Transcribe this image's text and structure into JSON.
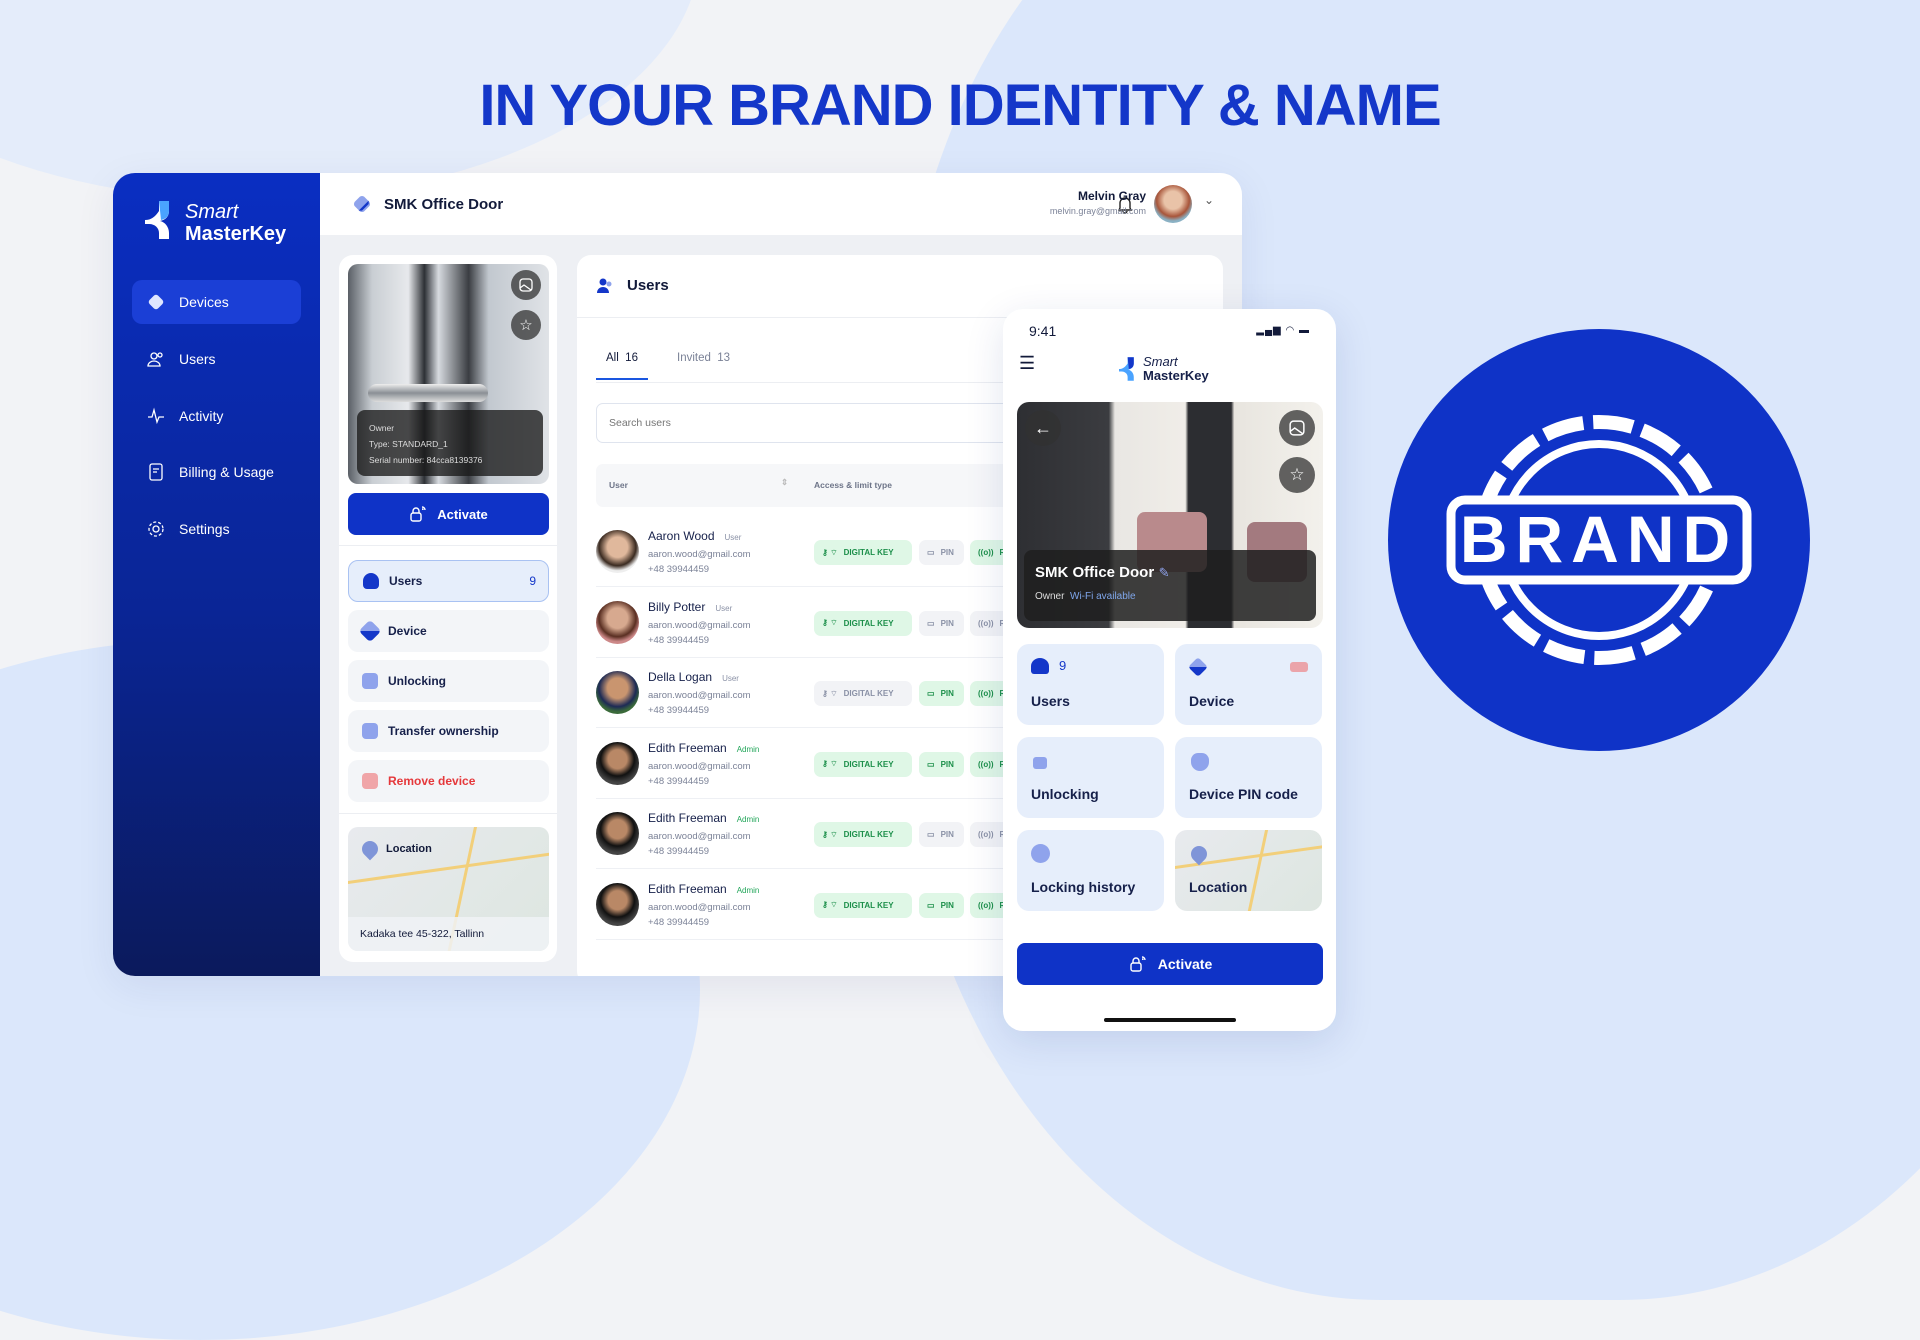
{
  "headline": "IN YOUR BRAND IDENTITY & NAME",
  "colors": {
    "brand": "#1437c9",
    "sidebar": "#0a2ec2",
    "button": "#0f33c7",
    "chip_active_bg": "#dff7e6",
    "chip_active_text": "#1c8f4a",
    "danger": "#e5383b",
    "admin_role": "#22a65a"
  },
  "logo": {
    "line1": "Smart",
    "line2": "MasterKey"
  },
  "sidebar": {
    "items": [
      {
        "label": "Devices",
        "icon": "device-icon",
        "active": true
      },
      {
        "label": "Users",
        "icon": "users-icon"
      },
      {
        "label": "Activity",
        "icon": "activity-icon"
      },
      {
        "label": "Billing & Usage",
        "icon": "receipt-icon"
      },
      {
        "label": "Settings",
        "icon": "gear-icon"
      }
    ]
  },
  "header": {
    "title": "SMK Office Door",
    "user_name": "Melvin Gray",
    "user_email": "melvin.gray@gmail.com"
  },
  "device": {
    "owner": "Owner",
    "type": "Type: STANDARD_1",
    "serial": "Serial number: 84cca8139376",
    "activate": "Activate",
    "menu": [
      {
        "label": "Users",
        "count": "9"
      },
      {
        "label": "Device"
      },
      {
        "label": "Unlocking"
      },
      {
        "label": "Transfer ownership"
      },
      {
        "label": "Remove device"
      }
    ],
    "location_label": "Location",
    "address": "Kadaka tee 45-322, Tallinn"
  },
  "users": {
    "title": "Users",
    "tabs": [
      {
        "label": "All",
        "count": "16",
        "active": true
      },
      {
        "label": "Invited",
        "count": "13"
      }
    ],
    "search_placeholder": "Search users",
    "columns": [
      "User",
      "Access & limit type"
    ],
    "chip_labels": {
      "digital": "DIGITAL KEY",
      "pin": "PIN",
      "rf": "RF"
    },
    "rows": [
      {
        "name": "Aaron Wood",
        "role": "User",
        "email": "aaron.wood@gmail.com",
        "phone": "+48 39944459",
        "digital": true,
        "pin": false,
        "rf": true
      },
      {
        "name": "Billy Potter",
        "role": "User",
        "email": "aaron.wood@gmail.com",
        "phone": "+48 39944459",
        "digital": true,
        "pin": false,
        "rf": false
      },
      {
        "name": "Della Logan",
        "role": "User",
        "email": "aaron.wood@gmail.com",
        "phone": "+48 39944459",
        "digital": false,
        "pin": true,
        "rf": true
      },
      {
        "name": "Edith Freeman",
        "role": "Admin",
        "email": "aaron.wood@gmail.com",
        "phone": "+48 39944459",
        "digital": true,
        "pin": true,
        "rf": true
      },
      {
        "name": "Edith Freeman",
        "role": "Admin",
        "email": "aaron.wood@gmail.com",
        "phone": "+48 39944459",
        "digital": true,
        "pin": false,
        "rf": false
      },
      {
        "name": "Edith Freeman",
        "role": "Admin",
        "email": "aaron.wood@gmail.com",
        "phone": "+48 39944459",
        "digital": true,
        "pin": true,
        "rf": true
      }
    ]
  },
  "phone": {
    "time": "9:41",
    "device_name": "SMK Office Door",
    "owner": "Owner",
    "wifi": "Wi-Fi available",
    "tiles": [
      {
        "label": "Users",
        "count": "9"
      },
      {
        "label": "Device"
      },
      {
        "label": "Unlocking"
      },
      {
        "label": "Device PIN code"
      },
      {
        "label": "Locking history"
      },
      {
        "label": "Location"
      }
    ],
    "activate": "Activate"
  },
  "badge": {
    "text": "BRAND"
  }
}
